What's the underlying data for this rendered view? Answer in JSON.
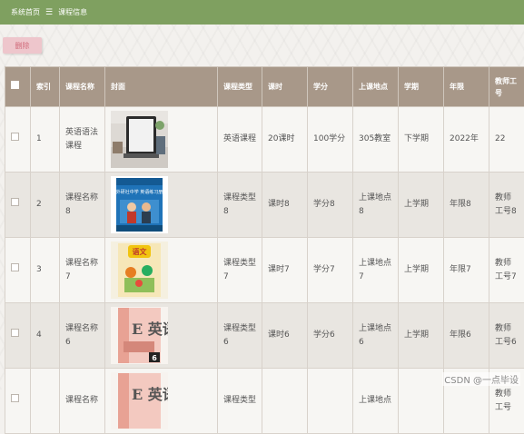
{
  "breadcrumb": {
    "home": "系统首页",
    "separator": "☰",
    "current": "课程信息"
  },
  "toolbar": {
    "delete_label": "删除"
  },
  "table": {
    "headers": [
      "",
      "索引",
      "课程名称",
      "封面",
      "课程类型",
      "课时",
      "学分",
      "上课地点",
      "学期",
      "年限",
      "教师工号"
    ],
    "rows": [
      {
        "index": "1",
        "name": "英语语法课程",
        "cover": "laptop-photo",
        "type": "英语课程",
        "hours": "20课时",
        "credit": "100学分",
        "location": "305教室",
        "term": "下学期",
        "year": "2022年",
        "teacher": "22"
      },
      {
        "index": "2",
        "name": "课程名称8",
        "cover": "blue-textbook",
        "type": "课程类型8",
        "hours": "课时8",
        "credit": "学分8",
        "location": "上课地点8",
        "term": "上学期",
        "year": "年限8",
        "teacher": "教师工号8"
      },
      {
        "index": "3",
        "name": "课程名称7",
        "cover": "chinese-textbook",
        "type": "课程类型7",
        "hours": "课时7",
        "credit": "学分7",
        "location": "上课地点7",
        "term": "上学期",
        "year": "年限7",
        "teacher": "教师工号7"
      },
      {
        "index": "4",
        "name": "课程名称6",
        "cover": "english-textbook-6",
        "type": "课程类型6",
        "hours": "课时6",
        "credit": "学分6",
        "location": "上课地点6",
        "term": "上学期",
        "year": "年限6",
        "teacher": "教师工号6"
      },
      {
        "index": "",
        "name": "课程名称",
        "cover": "english-textbook",
        "type": "课程类型",
        "hours": "",
        "credit": "",
        "location": "上课地点",
        "term": "",
        "year": "",
        "teacher": "教师工号"
      }
    ]
  },
  "cover_texts": {
    "blue_book": "外研社中学 英语练习册",
    "chinese_book": "语文",
    "english_book_title": "E 英语",
    "english_book_grade": "6"
  },
  "watermark": "CSDN @一点毕设"
}
